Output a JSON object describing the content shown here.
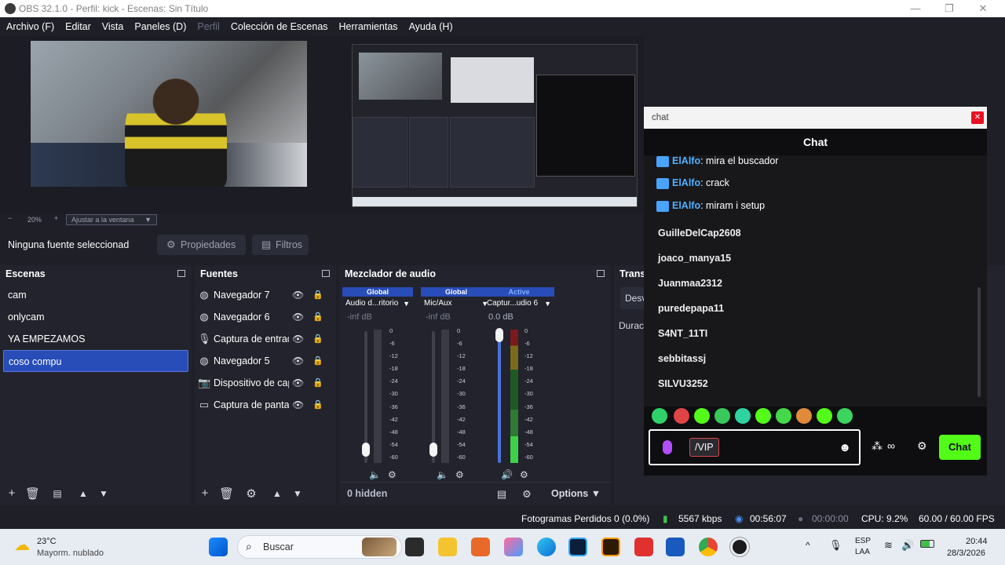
{
  "window": {
    "title": "OBS 32.1.0 - Perfil: kick - Escenas: Sin Título",
    "controls": {
      "minimize": "—",
      "maximize": "❐",
      "close": "✕"
    }
  },
  "menu": [
    "Archivo (F)",
    "Editar",
    "Vista",
    "Paneles (D)",
    "Perfil",
    "Colección de Escenas",
    "Herramientas",
    "Ayuda (H)"
  ],
  "preview": {
    "zoom_minus": "−",
    "zoom_value": "20%",
    "zoom_plus": "+",
    "zoom_select": "Ajustar a la ventana"
  },
  "source_toolbar": {
    "no_source": "Ninguna fuente seleccionad",
    "properties": "Propiedades",
    "filters": "Filtros"
  },
  "scenes": {
    "title": "Escenas",
    "items": [
      "cam",
      "onlycam",
      "YA EMPEZAMOS",
      "coso compu"
    ],
    "selected_index": 3
  },
  "sources": {
    "title": "Fuentes",
    "items": [
      {
        "label": "Navegador 7",
        "icon": "globe-icon"
      },
      {
        "label": "Navegador 6",
        "icon": "globe-icon"
      },
      {
        "label": "Captura de entrada",
        "icon": "microphone-icon"
      },
      {
        "label": "Navegador 5",
        "icon": "globe-icon"
      },
      {
        "label": "Dispositivo de captura",
        "icon": "camera-icon"
      },
      {
        "label": "Captura de pantalla",
        "icon": "monitor-icon"
      }
    ]
  },
  "mixer": {
    "title": "Mezclador de audio",
    "channels": [
      {
        "tag": "Global",
        "name": "Audio d...ritorio",
        "db": "-inf dB",
        "level": 0.0,
        "muted": true
      },
      {
        "tag": "Global",
        "name": "Mic/Aux",
        "db": "-inf dB",
        "level": 0.0,
        "muted": true
      },
      {
        "tag": "Active",
        "name": "Captur...udio 6",
        "db": "0.0 dB",
        "level": 1.0,
        "muted": false
      }
    ],
    "scale": [
      "0",
      "-6",
      "-12",
      "-18",
      "-24",
      "-30",
      "-36",
      "-42",
      "-48",
      "-54",
      "-60"
    ],
    "hidden": "0 hidden",
    "options": "Options"
  },
  "transitions": {
    "title": "Trans",
    "select": "Desv",
    "duration": "Durac"
  },
  "status": {
    "dropped_frames": "Fotogramas Perdidos 0 (0.0%)",
    "bitrate": "5567 kbps",
    "stream_time": "00:56:07",
    "rec_time": "00:00:00",
    "cpu": "CPU: 9.2%",
    "fps": "60.00 / 60.00 FPS"
  },
  "chat": {
    "window_title": "chat",
    "header": "Chat",
    "messages": [
      {
        "user": "ElAlfo",
        "text": ": mira el buscador"
      },
      {
        "user": "ElAlfo",
        "text": ": crack"
      },
      {
        "user": "ElAlfo",
        "text": ": miram i setup"
      }
    ],
    "users": [
      "GuilleDelCap2608",
      "joaco_manya15",
      "Juanmaa2312",
      "puredepapa11",
      "S4NT_11TI",
      "sebbitassj",
      "SILVU3252"
    ],
    "input_command": "/VIP",
    "send_label": "Chat",
    "colors": {
      "accent": "#53fc18",
      "username": "#4fb0ff"
    }
  },
  "taskbar": {
    "weather_temp": "23°C",
    "weather_desc": "Mayorm. nublado",
    "search_placeholder": "Buscar",
    "lang_top": "ESP",
    "lang_bottom": "LAA",
    "time": "20:44",
    "date": "28/3/2026"
  }
}
